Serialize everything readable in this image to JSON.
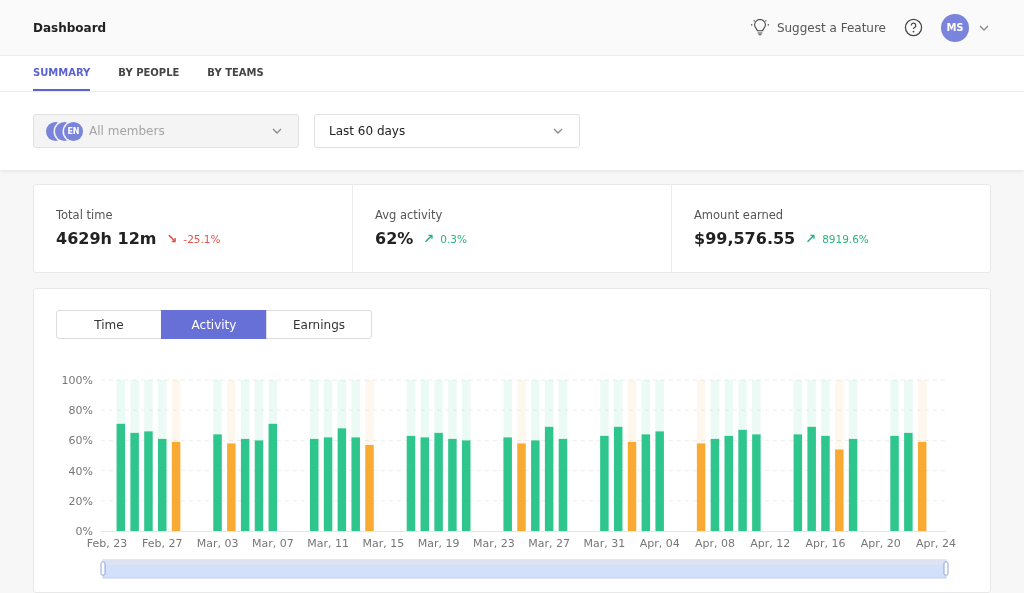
{
  "header": {
    "title": "Dashboard",
    "suggest": "Suggest a Feature",
    "user_initials": "MS"
  },
  "tabs": [
    {
      "label": "SUMMARY",
      "selected": true
    },
    {
      "label": "BY PEOPLE",
      "selected": false
    },
    {
      "label": "BY TEAMS",
      "selected": false
    }
  ],
  "filters": {
    "members": {
      "placeholder": "All members",
      "disabled": true,
      "avatars": [
        {
          "kind": "covered"
        },
        {
          "kind": "covered"
        },
        {
          "kind": "initials",
          "text": "EN"
        }
      ]
    },
    "range": {
      "value": "Last 60 days",
      "disabled": false
    }
  },
  "stats": [
    {
      "label": "Total time",
      "value": "4629h 12m",
      "change": "-25.1%",
      "arrow": "↘",
      "color": "#e8504a"
    },
    {
      "label": "Avg activity",
      "value": "62%",
      "change": "0.3%",
      "arrow": "↗",
      "color": "#27b47a"
    },
    {
      "label": "Amount earned",
      "value": "$99,576.55",
      "change": "8919.6%",
      "arrow": "↗",
      "color": "#27b47a"
    }
  ],
  "chart_tabs": [
    {
      "label": "Time",
      "selected": false
    },
    {
      "label": "Activity",
      "selected": true
    },
    {
      "label": "Earnings",
      "selected": false
    }
  ],
  "chart_data": {
    "type": "bar",
    "grid": true,
    "categories": [
      "Feb, 23",
      null,
      null,
      null,
      "Feb, 27",
      null,
      null,
      null,
      "Mar, 03",
      null,
      null,
      null,
      "Mar, 07",
      null,
      null,
      null,
      "Mar, 11",
      null,
      null,
      null,
      "Mar, 15",
      null,
      null,
      null,
      "Mar, 19",
      null,
      null,
      null,
      "Mar, 23",
      null,
      null,
      null,
      "Mar, 27",
      null,
      null,
      null,
      "Mar, 31",
      null,
      null,
      null,
      "Apr, 04",
      null,
      null,
      null,
      "Apr, 08",
      null,
      null,
      null,
      "Apr, 12",
      null,
      null,
      null,
      "Apr, 16",
      null,
      null,
      null,
      "Apr, 20",
      null,
      null,
      null,
      "Apr, 24"
    ],
    "ylim": [
      0,
      100
    ],
    "yticks": [
      {
        "value": 0,
        "label": "0%"
      },
      {
        "value": 20,
        "label": "20%"
      },
      {
        "value": 40,
        "label": "40%"
      },
      {
        "value": 60,
        "label": "60%"
      },
      {
        "value": 80,
        "label": "80%"
      },
      {
        "value": 100,
        "label": "100%"
      }
    ],
    "series": [
      {
        "color": "#2ec68c",
        "values": [
          null,
          71,
          65,
          66,
          61,
          null,
          null,
          null,
          64,
          null,
          61,
          60,
          71,
          null,
          null,
          61,
          62,
          68,
          62,
          null,
          null,
          null,
          63,
          62,
          65,
          61,
          60,
          null,
          null,
          62,
          null,
          60,
          69,
          61,
          null,
          null,
          63,
          69,
          null,
          64,
          66,
          null,
          null,
          null,
          61,
          63,
          67,
          64,
          null,
          null,
          64,
          69,
          63,
          null,
          61,
          null,
          null,
          63,
          65,
          null,
          null
        ]
      },
      {
        "color": "#f8aa33",
        "values": [
          null,
          null,
          null,
          null,
          null,
          59,
          null,
          null,
          null,
          58,
          null,
          null,
          null,
          null,
          null,
          null,
          null,
          null,
          null,
          57,
          null,
          null,
          null,
          null,
          null,
          null,
          null,
          null,
          null,
          null,
          58,
          null,
          null,
          null,
          null,
          null,
          null,
          null,
          59,
          null,
          null,
          null,
          null,
          58,
          null,
          null,
          null,
          null,
          null,
          null,
          null,
          null,
          null,
          54,
          null,
          null,
          null,
          null,
          null,
          59,
          null
        ]
      }
    ]
  }
}
